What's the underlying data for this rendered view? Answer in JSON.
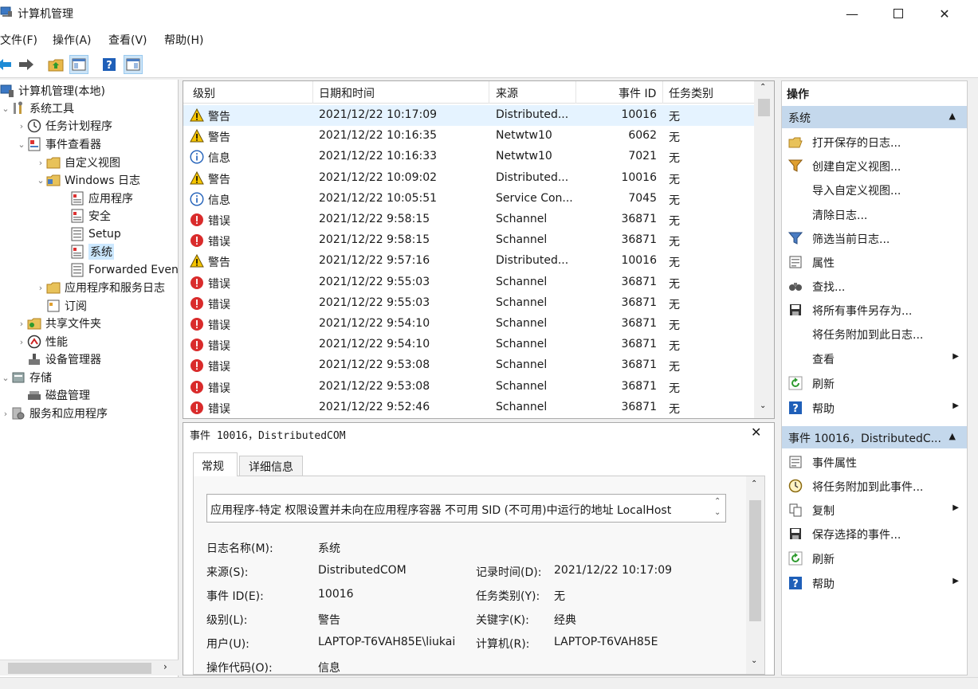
{
  "window": {
    "title": "计算机管理"
  },
  "menu": {
    "items": [
      "文件(F)",
      "操作(A)",
      "查看(V)",
      "帮助(H)"
    ]
  },
  "tree": {
    "root": "计算机管理(本地)",
    "system_tools": "系统工具",
    "task_scheduler": "任务计划程序",
    "event_viewer": "事件查看器",
    "custom_views": "自定义视图",
    "windows_logs": "Windows 日志",
    "application": "应用程序",
    "security": "安全",
    "setup": "Setup",
    "system": "系统",
    "forwarded": "Forwarded Even",
    "app_service_logs": "应用程序和服务日志",
    "subscriptions": "订阅",
    "shared_folders": "共享文件夹",
    "performance": "性能",
    "device_manager": "设备管理器",
    "storage": "存储",
    "disk_management": "磁盘管理",
    "services_apps": "服务和应用程序"
  },
  "events": {
    "columns": [
      "级别",
      "日期和时间",
      "来源",
      "事件 ID",
      "任务类别"
    ],
    "rows": [
      {
        "level": "警告",
        "type": "warning",
        "datetime": "2021/12/22 10:17:09",
        "source": "Distributed...",
        "id": "10016",
        "task": "无"
      },
      {
        "level": "警告",
        "type": "warning",
        "datetime": "2021/12/22 10:16:35",
        "source": "Netwtw10",
        "id": "6062",
        "task": "无"
      },
      {
        "level": "信息",
        "type": "info",
        "datetime": "2021/12/22 10:16:33",
        "source": "Netwtw10",
        "id": "7021",
        "task": "无"
      },
      {
        "level": "警告",
        "type": "warning",
        "datetime": "2021/12/22 10:09:02",
        "source": "Distributed...",
        "id": "10016",
        "task": "无"
      },
      {
        "level": "信息",
        "type": "info",
        "datetime": "2021/12/22 10:05:51",
        "source": "Service Con...",
        "id": "7045",
        "task": "无"
      },
      {
        "level": "错误",
        "type": "error",
        "datetime": "2021/12/22 9:58:15",
        "source": "Schannel",
        "id": "36871",
        "task": "无"
      },
      {
        "level": "错误",
        "type": "error",
        "datetime": "2021/12/22 9:58:15",
        "source": "Schannel",
        "id": "36871",
        "task": "无"
      },
      {
        "level": "警告",
        "type": "warning",
        "datetime": "2021/12/22 9:57:16",
        "source": "Distributed...",
        "id": "10016",
        "task": "无"
      },
      {
        "level": "错误",
        "type": "error",
        "datetime": "2021/12/22 9:55:03",
        "source": "Schannel",
        "id": "36871",
        "task": "无"
      },
      {
        "level": "错误",
        "type": "error",
        "datetime": "2021/12/22 9:55:03",
        "source": "Schannel",
        "id": "36871",
        "task": "无"
      },
      {
        "level": "错误",
        "type": "error",
        "datetime": "2021/12/22 9:54:10",
        "source": "Schannel",
        "id": "36871",
        "task": "无"
      },
      {
        "level": "错误",
        "type": "error",
        "datetime": "2021/12/22 9:54:10",
        "source": "Schannel",
        "id": "36871",
        "task": "无"
      },
      {
        "level": "错误",
        "type": "error",
        "datetime": "2021/12/22 9:53:08",
        "source": "Schannel",
        "id": "36871",
        "task": "无"
      },
      {
        "level": "错误",
        "type": "error",
        "datetime": "2021/12/22 9:53:08",
        "source": "Schannel",
        "id": "36871",
        "task": "无"
      },
      {
        "level": "错误",
        "type": "error",
        "datetime": "2021/12/22 9:52:46",
        "source": "Schannel",
        "id": "36871",
        "task": "无"
      }
    ]
  },
  "detail": {
    "title": "事件 10016，DistributedCOM",
    "tab_general": "常规",
    "tab_details": "详细信息",
    "message": "应用程序-特定 权限设置并未向在应用程序容器 不可用 SID (不可用)中运行的地址 LocalHost",
    "log_name_label": "日志名称(M):",
    "log_name": "系统",
    "source_label": "来源(S):",
    "source": "DistributedCOM",
    "logged_label": "记录时间(D):",
    "logged": "2021/12/22 10:17:09",
    "event_id_label": "事件 ID(E):",
    "event_id": "10016",
    "task_label": "任务类别(Y):",
    "task": "无",
    "level_label": "级别(L):",
    "level": "警告",
    "keywords_label": "关键字(K):",
    "keywords": "经典",
    "user_label": "用户(U):",
    "user": "LAPTOP-T6VAH85E\\liukai",
    "computer_label": "计算机(R):",
    "computer": "LAPTOP-T6VAH85E",
    "opcode_label": "操作代码(O):",
    "opcode": "信息"
  },
  "actions": {
    "header": "操作",
    "section1": "系统",
    "open_saved": "打开保存的日志...",
    "create_view": "创建自定义视图...",
    "import_view": "导入自定义视图...",
    "clear_log": "清除日志...",
    "filter_log": "筛选当前日志...",
    "properties": "属性",
    "find": "查找...",
    "save_all": "将所有事件另存为...",
    "attach_task_log": "将任务附加到此日志...",
    "view": "查看",
    "refresh": "刷新",
    "help": "帮助",
    "section2": "事件 10016，DistributedC...",
    "event_props": "事件属性",
    "attach_task_event": "将任务附加到此事件...",
    "copy": "复制",
    "save_selected": "保存选择的事件...",
    "refresh2": "刷新",
    "help2": "帮助"
  }
}
